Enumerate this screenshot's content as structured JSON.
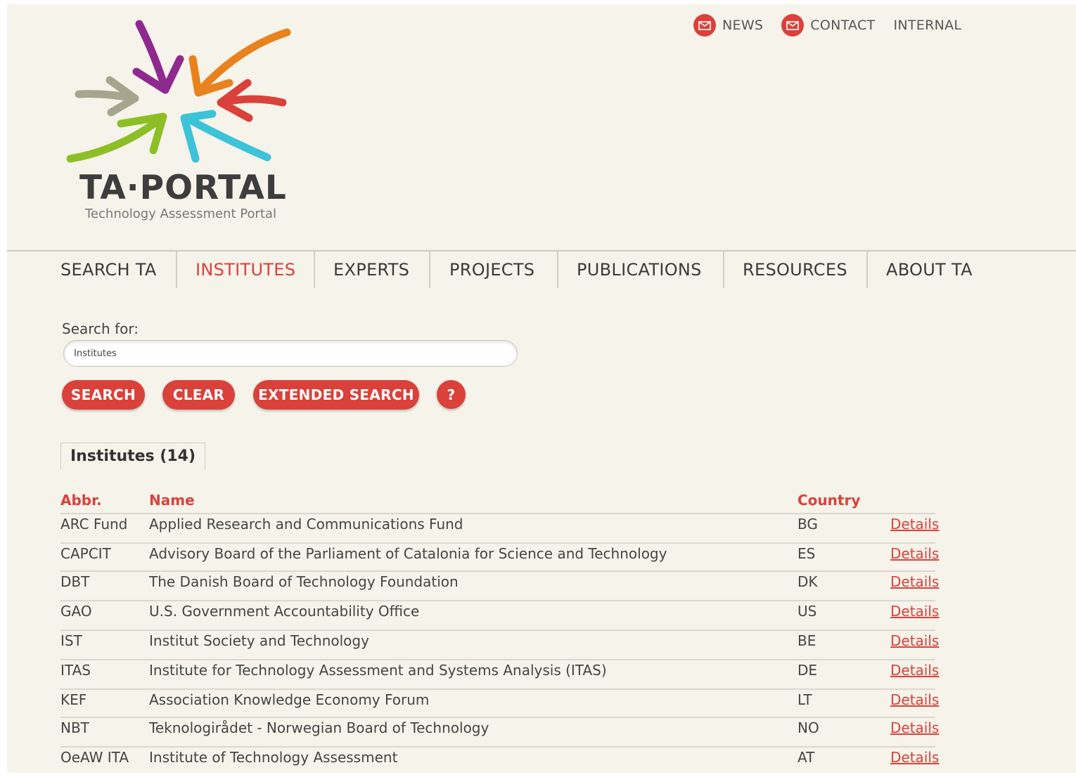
{
  "top_links": [
    {
      "label": "NEWS",
      "icon": "mail-icon"
    },
    {
      "label": "CONTACT",
      "icon": "mail-icon"
    },
    {
      "label": "INTERNAL"
    }
  ],
  "logo": {
    "title": "TA·PORTAL",
    "subtitle": "Technology Assessment Portal"
  },
  "nav": [
    {
      "label": "SEARCH TA",
      "active": false
    },
    {
      "label": "INSTITUTES",
      "active": true
    },
    {
      "label": "EXPERTS",
      "active": false
    },
    {
      "label": "PROJECTS",
      "active": false
    },
    {
      "label": "PUBLICATIONS",
      "active": false
    },
    {
      "label": "RESOURCES",
      "active": false
    },
    {
      "label": "ABOUT TA",
      "active": false
    }
  ],
  "search": {
    "label": "Search for:",
    "value": "Institutes",
    "buttons": {
      "search": "SEARCH",
      "clear": "CLEAR",
      "extended": "EXTENDED SEARCH",
      "help": "?"
    }
  },
  "results": {
    "tab_label": "Institutes (14)",
    "columns": {
      "abbr": "Abbr.",
      "name": "Name",
      "country": "Country"
    },
    "rows": [
      {
        "abbr": "ARC Fund",
        "name": "Applied Research and Communications Fund",
        "country": "BG",
        "link": "Details"
      },
      {
        "abbr": "CAPCIT",
        "name": "Advisory Board of the Parliament of Catalonia for Science and Technology",
        "country": "ES",
        "link": "Details"
      },
      {
        "abbr": "DBT",
        "name": "The Danish Board of Technology Foundation",
        "country": "DK",
        "link": "Details"
      },
      {
        "abbr": "GAO",
        "name": "U.S. Government Accountability Office",
        "country": "US",
        "link": "Details"
      },
      {
        "abbr": "IST",
        "name": "Institut Society and Technology",
        "country": "BE",
        "link": "Details"
      },
      {
        "abbr": "ITAS",
        "name": "Institute for Technology Assessment and Systems Analysis (ITAS)",
        "country": "DE",
        "link": "Details"
      },
      {
        "abbr": "KEF",
        "name": "Association Knowledge Economy Forum",
        "country": "LT",
        "link": "Details"
      },
      {
        "abbr": "NBT",
        "name": "Teknologirådet - Norwegian Board of Technology",
        "country": "NO",
        "link": "Details"
      },
      {
        "abbr": "OeAW ITA",
        "name": "Institute of Technology Assessment",
        "country": "AT",
        "link": "Details"
      }
    ]
  },
  "colors": {
    "accent": "#d9413a",
    "background": "#f6f3ea",
    "logo_arrows": [
      "#8e2a8e",
      "#e8821e",
      "#d9413a",
      "#a8a58f",
      "#8cbf26",
      "#3cc3d8"
    ]
  }
}
